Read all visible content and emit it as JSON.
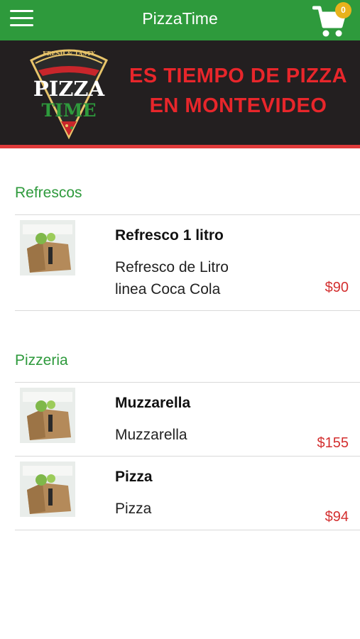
{
  "header": {
    "title": "PizzaTime",
    "cart_count": "0",
    "accent": "#2e9a3c"
  },
  "banner": {
    "logo_top": "FRESH & TASTY",
    "logo_word1": "PIZZA",
    "logo_word2": "TIME",
    "line1": "ES TIEMPO DE PIZZA",
    "line2": "EN MONTEVIDEO"
  },
  "sections": [
    {
      "title": "Refrescos",
      "items": [
        {
          "name": "Refresco 1 litro",
          "desc_line1": "Refresco de Litro",
          "desc_line2": "linea Coca Cola",
          "price": "$90"
        }
      ]
    },
    {
      "title": "Pizzeria",
      "items": [
        {
          "name": "Muzzarella",
          "desc_line1": "Muzzarella",
          "price": "$155"
        },
        {
          "name": "Pizza",
          "desc_line1": "Pizza",
          "price": "$94"
        }
      ]
    }
  ],
  "icons": [
    "menu-icon",
    "cart-icon"
  ]
}
